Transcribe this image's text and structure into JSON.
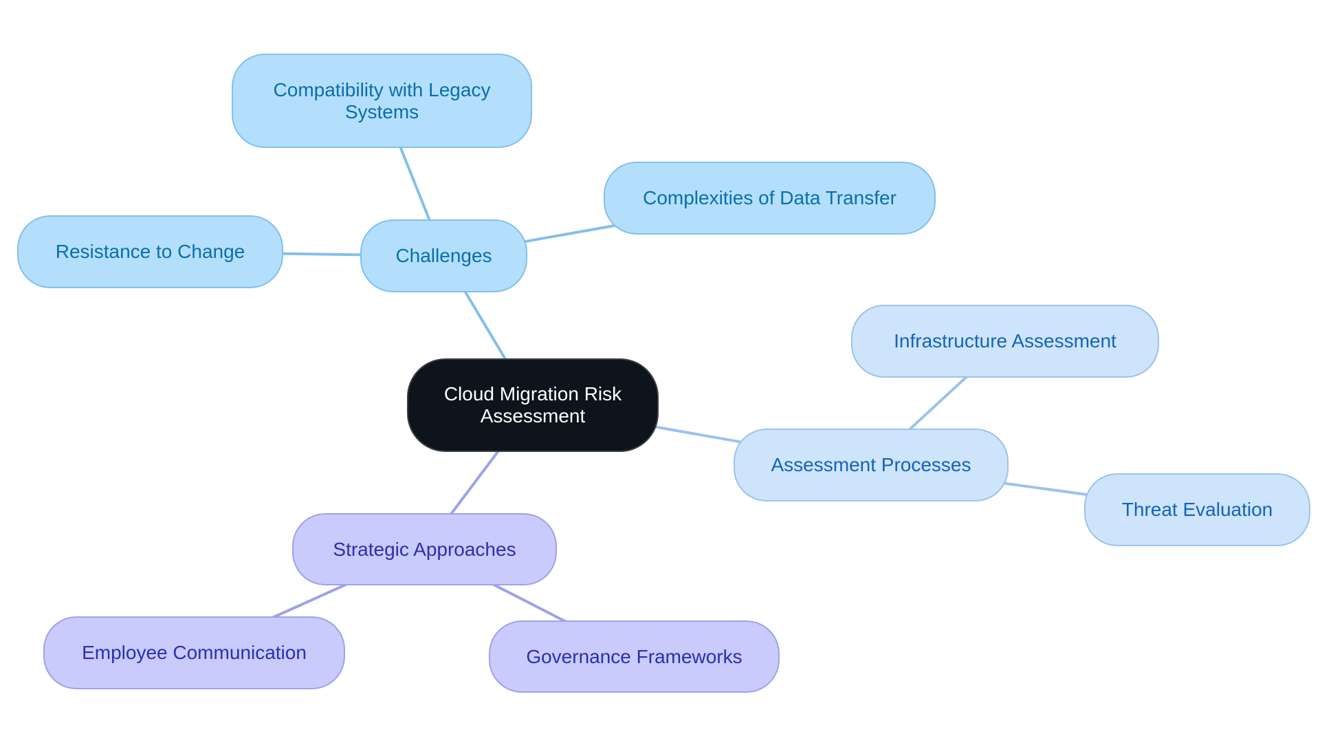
{
  "diagram": {
    "type": "mindmap",
    "colors": {
      "root_fill": "#0d141b",
      "root_text": "#ffffff",
      "challenges_fill": "#b3dffc",
      "challenges_text": "#0b6eab",
      "challenges_edge": "#83c0ea",
      "assessment_fill": "#cde4fb",
      "assessment_text": "#1464b8",
      "assessment_edge": "#9bc3ec",
      "strategy_fill": "#c8cbfc",
      "strategy_text": "#2b2fae",
      "strategy_edge": "#9da3e8"
    },
    "root": {
      "id": "root",
      "label": "Cloud Migration Risk Assessment"
    },
    "nodes": [
      {
        "id": "challenges",
        "label": "Challenges",
        "parent": "root",
        "branch": "challenges"
      },
      {
        "id": "compat",
        "label": "Compatibility with Legacy Systems",
        "parent": "challenges",
        "branch": "challenges"
      },
      {
        "id": "complex",
        "label": "Complexities of Data Transfer",
        "parent": "challenges",
        "branch": "challenges"
      },
      {
        "id": "resist",
        "label": "Resistance to Change",
        "parent": "challenges",
        "branch": "challenges"
      },
      {
        "id": "assess",
        "label": "Assessment Processes",
        "parent": "root",
        "branch": "assessment"
      },
      {
        "id": "infra",
        "label": "Infrastructure Assessment",
        "parent": "assess",
        "branch": "assessment"
      },
      {
        "id": "threat",
        "label": "Threat Evaluation",
        "parent": "assess",
        "branch": "assessment"
      },
      {
        "id": "strategy",
        "label": "Strategic Approaches",
        "parent": "root",
        "branch": "strategy"
      },
      {
        "id": "employee",
        "label": "Employee Communication",
        "parent": "strategy",
        "branch": "strategy"
      },
      {
        "id": "governance",
        "label": "Governance Frameworks",
        "parent": "strategy",
        "branch": "strategy"
      }
    ]
  }
}
